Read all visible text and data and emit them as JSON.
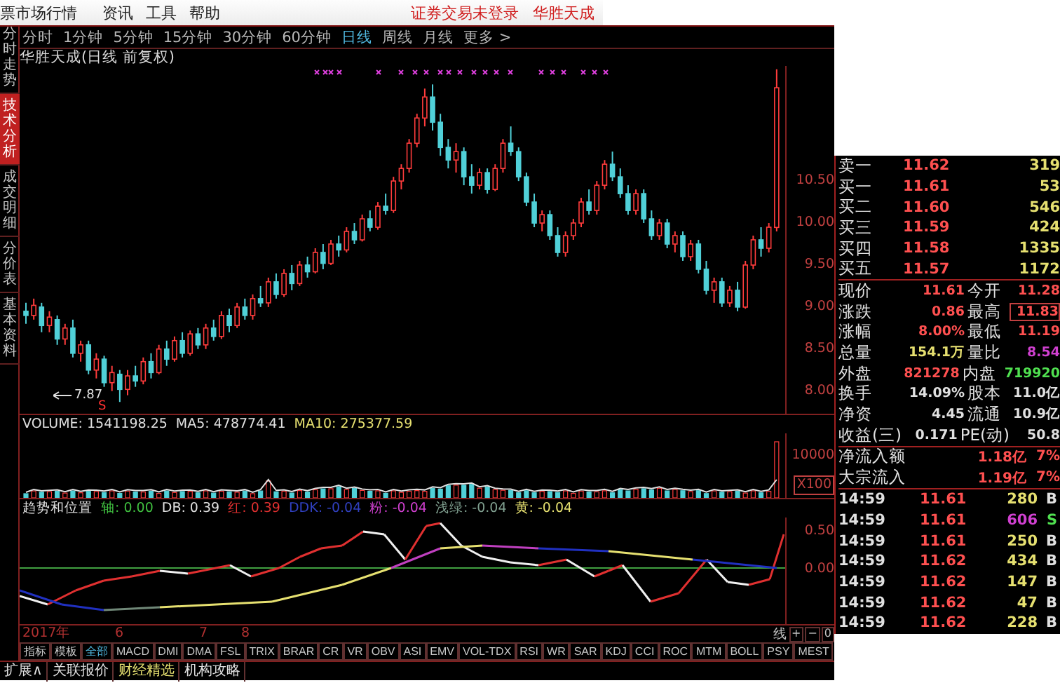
{
  "menu": {
    "items": [
      "票市场行情",
      "资讯",
      "工具",
      "帮助"
    ],
    "status": [
      "证券交易未登录",
      "华胜天成"
    ]
  },
  "side_tabs": [
    {
      "label": "分时走势",
      "selected": false
    },
    {
      "label": "技术分析",
      "selected": true
    },
    {
      "label": "成交明细",
      "selected": false
    },
    {
      "label": "分价表",
      "selected": false
    },
    {
      "label": "基本资料",
      "selected": false
    }
  ],
  "periods": [
    {
      "label": "分时",
      "selected": false
    },
    {
      "label": "1分钟",
      "selected": false
    },
    {
      "label": "5分钟",
      "selected": false
    },
    {
      "label": "15分钟",
      "selected": false
    },
    {
      "label": "30分钟",
      "selected": false
    },
    {
      "label": "60分钟",
      "selected": false
    },
    {
      "label": "日线",
      "selected": true
    },
    {
      "label": "周线",
      "selected": false
    },
    {
      "label": "月线",
      "selected": false
    },
    {
      "label": "更多 >",
      "selected": false
    }
  ],
  "chart_title": "华胜天成(日线 前复权)",
  "price_chart": {
    "chart_data": {
      "type": "candlestick",
      "ylim": [
        7.73,
        11.87
      ],
      "ohlc": [
        [
          8.95,
          9.05,
          8.8,
          8.9
        ],
        [
          8.9,
          9.1,
          8.85,
          9.02
        ],
        [
          9.0,
          9.05,
          8.7,
          8.78
        ],
        [
          8.78,
          8.95,
          8.7,
          8.88
        ],
        [
          8.85,
          8.9,
          8.55,
          8.62
        ],
        [
          8.62,
          8.8,
          8.55,
          8.75
        ],
        [
          8.75,
          8.85,
          8.4,
          8.45
        ],
        [
          8.45,
          8.6,
          8.35,
          8.55
        ],
        [
          8.55,
          8.6,
          8.2,
          8.25
        ],
        [
          8.25,
          8.45,
          8.15,
          8.38
        ],
        [
          8.38,
          8.42,
          8.05,
          8.1
        ],
        [
          8.1,
          8.3,
          8.0,
          8.22
        ],
        [
          8.2,
          8.25,
          7.87,
          8.02
        ],
        [
          8.02,
          8.25,
          7.95,
          8.18
        ],
        [
          8.18,
          8.3,
          8.05,
          8.12
        ],
        [
          8.12,
          8.4,
          8.08,
          8.35
        ],
        [
          8.35,
          8.45,
          8.15,
          8.22
        ],
        [
          8.22,
          8.55,
          8.2,
          8.5
        ],
        [
          8.5,
          8.6,
          8.3,
          8.38
        ],
        [
          8.38,
          8.65,
          8.35,
          8.6
        ],
        [
          8.6,
          8.7,
          8.4,
          8.45
        ],
        [
          8.45,
          8.72,
          8.42,
          8.68
        ],
        [
          8.68,
          8.75,
          8.5,
          8.55
        ],
        [
          8.55,
          8.8,
          8.5,
          8.75
        ],
        [
          8.75,
          8.85,
          8.6,
          8.65
        ],
        [
          8.65,
          8.95,
          8.62,
          8.9
        ],
        [
          8.9,
          8.98,
          8.7,
          8.78
        ],
        [
          8.78,
          9.05,
          8.75,
          9.0
        ],
        [
          9.0,
          9.1,
          8.85,
          8.9
        ],
        [
          8.9,
          9.15,
          8.85,
          9.1
        ],
        [
          9.1,
          9.25,
          9.0,
          9.05
        ],
        [
          9.05,
          9.35,
          9.0,
          9.3
        ],
        [
          9.3,
          9.4,
          9.1,
          9.15
        ],
        [
          9.15,
          9.45,
          9.12,
          9.4
        ],
        [
          9.4,
          9.5,
          9.2,
          9.28
        ],
        [
          9.28,
          9.55,
          9.25,
          9.5
        ],
        [
          9.5,
          9.6,
          9.35,
          9.42
        ],
        [
          9.42,
          9.7,
          9.4,
          9.65
        ],
        [
          9.65,
          9.75,
          9.45,
          9.52
        ],
        [
          9.52,
          9.8,
          9.5,
          9.75
        ],
        [
          9.75,
          9.85,
          9.6,
          9.68
        ],
        [
          9.68,
          9.95,
          9.65,
          9.9
        ],
        [
          9.9,
          10.0,
          9.75,
          9.8
        ],
        [
          9.8,
          10.1,
          9.78,
          10.05
        ],
        [
          10.05,
          10.15,
          9.9,
          9.95
        ],
        [
          9.95,
          10.25,
          9.92,
          10.2
        ],
        [
          10.2,
          10.35,
          10.1,
          10.15
        ],
        [
          10.15,
          10.55,
          10.12,
          10.5
        ],
        [
          10.5,
          10.7,
          10.4,
          10.65
        ],
        [
          10.65,
          11.0,
          10.6,
          10.95
        ],
        [
          10.95,
          11.3,
          10.9,
          11.25
        ],
        [
          11.25,
          11.6,
          11.15,
          11.5
        ],
        [
          11.5,
          11.65,
          11.1,
          11.2
        ],
        [
          11.2,
          11.3,
          10.8,
          10.9
        ],
        [
          10.9,
          11.0,
          10.65,
          10.75
        ],
        [
          10.75,
          10.95,
          10.6,
          10.85
        ],
        [
          10.85,
          10.9,
          10.45,
          10.55
        ],
        [
          10.55,
          10.7,
          10.35,
          10.45
        ],
        [
          10.45,
          10.65,
          10.4,
          10.6
        ],
        [
          10.6,
          10.65,
          10.35,
          10.4
        ],
        [
          10.4,
          10.7,
          10.38,
          10.65
        ],
        [
          10.65,
          11.0,
          10.6,
          10.95
        ],
        [
          10.95,
          11.15,
          10.8,
          10.85
        ],
        [
          10.85,
          10.9,
          10.5,
          10.55
        ],
        [
          10.55,
          10.6,
          10.2,
          10.25
        ],
        [
          10.25,
          10.35,
          9.95,
          10.0
        ],
        [
          10.0,
          10.15,
          9.9,
          10.1
        ],
        [
          10.1,
          10.15,
          9.8,
          9.85
        ],
        [
          9.85,
          9.95,
          9.6,
          9.65
        ],
        [
          9.65,
          9.9,
          9.6,
          9.85
        ],
        [
          9.85,
          10.05,
          9.8,
          10.0
        ],
        [
          10.0,
          10.3,
          9.95,
          10.25
        ],
        [
          10.25,
          10.4,
          10.1,
          10.15
        ],
        [
          10.15,
          10.5,
          10.1,
          10.45
        ],
        [
          10.45,
          10.75,
          10.4,
          10.7
        ],
        [
          10.7,
          10.85,
          10.5,
          10.55
        ],
        [
          10.55,
          10.65,
          10.3,
          10.35
        ],
        [
          10.35,
          10.45,
          10.1,
          10.15
        ],
        [
          10.15,
          10.4,
          10.1,
          10.35
        ],
        [
          10.35,
          10.4,
          10.0,
          10.05
        ],
        [
          10.05,
          10.15,
          9.8,
          9.85
        ],
        [
          9.85,
          10.05,
          9.8,
          10.0
        ],
        [
          10.0,
          10.05,
          9.7,
          9.75
        ],
        [
          9.75,
          9.9,
          9.65,
          9.85
        ],
        [
          9.85,
          9.9,
          9.55,
          9.6
        ],
        [
          9.6,
          9.8,
          9.55,
          9.75
        ],
        [
          9.75,
          9.8,
          9.4,
          9.45
        ],
        [
          9.45,
          9.55,
          9.15,
          9.2
        ],
        [
          9.2,
          9.35,
          9.05,
          9.3
        ],
        [
          9.3,
          9.35,
          9.0,
          9.05
        ],
        [
          9.05,
          9.25,
          9.0,
          9.2
        ],
        [
          9.2,
          9.3,
          8.95,
          9.0
        ],
        [
          9.0,
          9.55,
          8.98,
          9.5
        ],
        [
          9.5,
          9.85,
          9.45,
          9.8
        ],
        [
          9.8,
          9.95,
          9.6,
          9.7
        ],
        [
          9.7,
          10.0,
          9.65,
          9.95
        ],
        [
          9.95,
          11.83,
          9.9,
          11.61
        ]
      ],
      "yticks": [
        {
          "value": 10.5,
          "label": "10.50"
        },
        {
          "value": 10.0,
          "label": "10.00"
        },
        {
          "value": 9.5,
          "label": "9.50"
        },
        {
          "value": 9.0,
          "label": "9.00"
        },
        {
          "value": 8.5,
          "label": "8.50"
        },
        {
          "value": 8.0,
          "label": "8.00"
        }
      ]
    }
  },
  "low_label": "7.87",
  "signal_label": "S",
  "volume": {
    "readings": [
      {
        "text": "VOLUME: 1541198.25",
        "color": "#e0e0e0"
      },
      {
        "text": "MA5: 478774.41",
        "color": "#e0e0e0"
      },
      {
        "text": "MA10: 275377.59",
        "color": "#e6e070"
      }
    ],
    "axis": [
      "10000",
      "X100"
    ]
  },
  "indicator": {
    "readings": [
      {
        "text": "趋势和位置",
        "color": "#e0e0e0"
      },
      {
        "text": "轴: 0.00",
        "color": "#40c040"
      },
      {
        "text": "DB: 0.39",
        "color": "#e0e0e0"
      },
      {
        "text": "红: 0.39",
        "color": "#e03030"
      },
      {
        "text": "DDK: -0.04",
        "color": "#3040c0"
      },
      {
        "text": "粉: -0.04",
        "color": "#d040d0"
      },
      {
        "text": "浅绿: -0.04",
        "color": "#80a090"
      },
      {
        "text": "黄: -0.04",
        "color": "#e6e070"
      }
    ],
    "axis": [
      "0.50",
      "0.00"
    ]
  },
  "dates": [
    "2017年",
    "6",
    "7",
    "8"
  ],
  "zoom_controls": {
    "label": "线",
    "buttons": [
      "+",
      "−",
      "0"
    ]
  },
  "indicator_tabs": [
    {
      "label": "指标",
      "selected": false
    },
    {
      "label": "模板",
      "selected": false
    },
    {
      "label": "全部",
      "selected": true
    },
    {
      "label": "MACD",
      "selected": false
    },
    {
      "label": "DMI",
      "selected": false
    },
    {
      "label": "DMA",
      "selected": false
    },
    {
      "label": "FSL",
      "selected": false
    },
    {
      "label": "TRIX",
      "selected": false
    },
    {
      "label": "BRAR",
      "selected": false
    },
    {
      "label": "CR",
      "selected": false
    },
    {
      "label": "VR",
      "selected": false
    },
    {
      "label": "OBV",
      "selected": false
    },
    {
      "label": "ASI",
      "selected": false
    },
    {
      "label": "EMV",
      "selected": false
    },
    {
      "label": "VOL-TDX",
      "selected": false
    },
    {
      "label": "RSI",
      "selected": false
    },
    {
      "label": "WR",
      "selected": false
    },
    {
      "label": "SAR",
      "selected": false
    },
    {
      "label": "KDJ",
      "selected": false
    },
    {
      "label": "CCI",
      "selected": false
    },
    {
      "label": "ROC",
      "selected": false
    },
    {
      "label": "MTM",
      "selected": false
    },
    {
      "label": "BOLL",
      "selected": false
    },
    {
      "label": "PSY",
      "selected": false
    },
    {
      "label": "MEST",
      "selected": false
    }
  ],
  "bottom_tabs": [
    {
      "label": "扩展∧",
      "highlighted": false
    },
    {
      "label": "关联报价",
      "highlighted": false
    },
    {
      "label": "财经精选",
      "highlighted": true
    },
    {
      "label": "机构攻略",
      "highlighted": false
    }
  ],
  "order_book": [
    {
      "label": "卖一",
      "price": "11.62",
      "volume": "319"
    },
    {
      "label": "买一",
      "price": "11.61",
      "volume": "53"
    },
    {
      "label": "买二",
      "price": "11.60",
      "volume": "546"
    },
    {
      "label": "买三",
      "price": "11.59",
      "volume": "424"
    },
    {
      "label": "买四",
      "price": "11.58",
      "volume": "1335"
    },
    {
      "label": "买五",
      "price": "11.57",
      "volume": "1172"
    }
  ],
  "quote": [
    {
      "cells": [
        {
          "label": "现价",
          "value": "11.61",
          "color": "#ff5050",
          "boxed": false
        },
        {
          "label": "今开",
          "value": "11.28",
          "color": "#ff5050",
          "boxed": false
        }
      ]
    },
    {
      "cells": [
        {
          "label": "涨跌",
          "value": "0.86",
          "color": "#ff5050",
          "boxed": false
        },
        {
          "label": "最高",
          "value": "11.83",
          "color": "#ff5050",
          "boxed": true
        }
      ]
    },
    {
      "cells": [
        {
          "label": "涨幅",
          "value": "8.00%",
          "color": "#ff5050",
          "boxed": false
        },
        {
          "label": "最低",
          "value": "11.19",
          "color": "#ff5050",
          "boxed": false
        }
      ]
    },
    {
      "cells": [
        {
          "label": "总量",
          "value": "154.1万",
          "color": "#e6e070",
          "boxed": false
        },
        {
          "label": "量比",
          "value": "8.54",
          "color": "#d040d0",
          "boxed": false
        }
      ]
    },
    {
      "cells": [
        {
          "label": "外盘",
          "value": "821278",
          "color": "#ff5050",
          "boxed": false
        },
        {
          "label": "内盘",
          "value": "719920",
          "color": "#50e050",
          "boxed": false
        }
      ]
    },
    {
      "cells": [
        {
          "label": "换手",
          "value": "14.09%",
          "color": "#e0e0e0",
          "boxed": false
        },
        {
          "label": "股本",
          "value": "11.0亿",
          "color": "#e0e0e0",
          "boxed": false
        }
      ]
    },
    {
      "cells": [
        {
          "label": "净资",
          "value": "4.45",
          "color": "#e0e0e0",
          "boxed": false
        },
        {
          "label": "流通",
          "value": "10.9亿",
          "color": "#e0e0e0",
          "boxed": false
        }
      ]
    },
    {
      "cells": [
        {
          "label": "收益(三)",
          "value": "0.171",
          "color": "#e0e0e0",
          "boxed": false
        },
        {
          "label": "PE(动)",
          "value": "50.8",
          "color": "#e0e0e0",
          "boxed": false
        }
      ]
    }
  ],
  "flow": [
    {
      "label": "净流入额",
      "value": "1.18亿",
      "percent": "7%"
    },
    {
      "label": "大宗流入",
      "value": "1.19亿",
      "percent": "7%"
    }
  ],
  "trades": [
    {
      "time": "14:59",
      "price": "11.61",
      "volume": "280",
      "side": "B",
      "kind": "buy"
    },
    {
      "time": "14:59",
      "price": "11.61",
      "volume": "606",
      "side": "S",
      "kind": "sell"
    },
    {
      "time": "14:59",
      "price": "11.61",
      "volume": "250",
      "side": "B",
      "kind": "buy"
    },
    {
      "time": "14:59",
      "price": "11.62",
      "volume": "434",
      "side": "B",
      "kind": "buy"
    },
    {
      "time": "14:59",
      "price": "11.62",
      "volume": "147",
      "side": "B",
      "kind": "buy"
    },
    {
      "time": "14:59",
      "price": "11.62",
      "volume": "47",
      "side": "B",
      "kind": "buy"
    },
    {
      "time": "14:59",
      "price": "11.62",
      "volume": "228",
      "side": "B",
      "kind": "buy"
    }
  ]
}
